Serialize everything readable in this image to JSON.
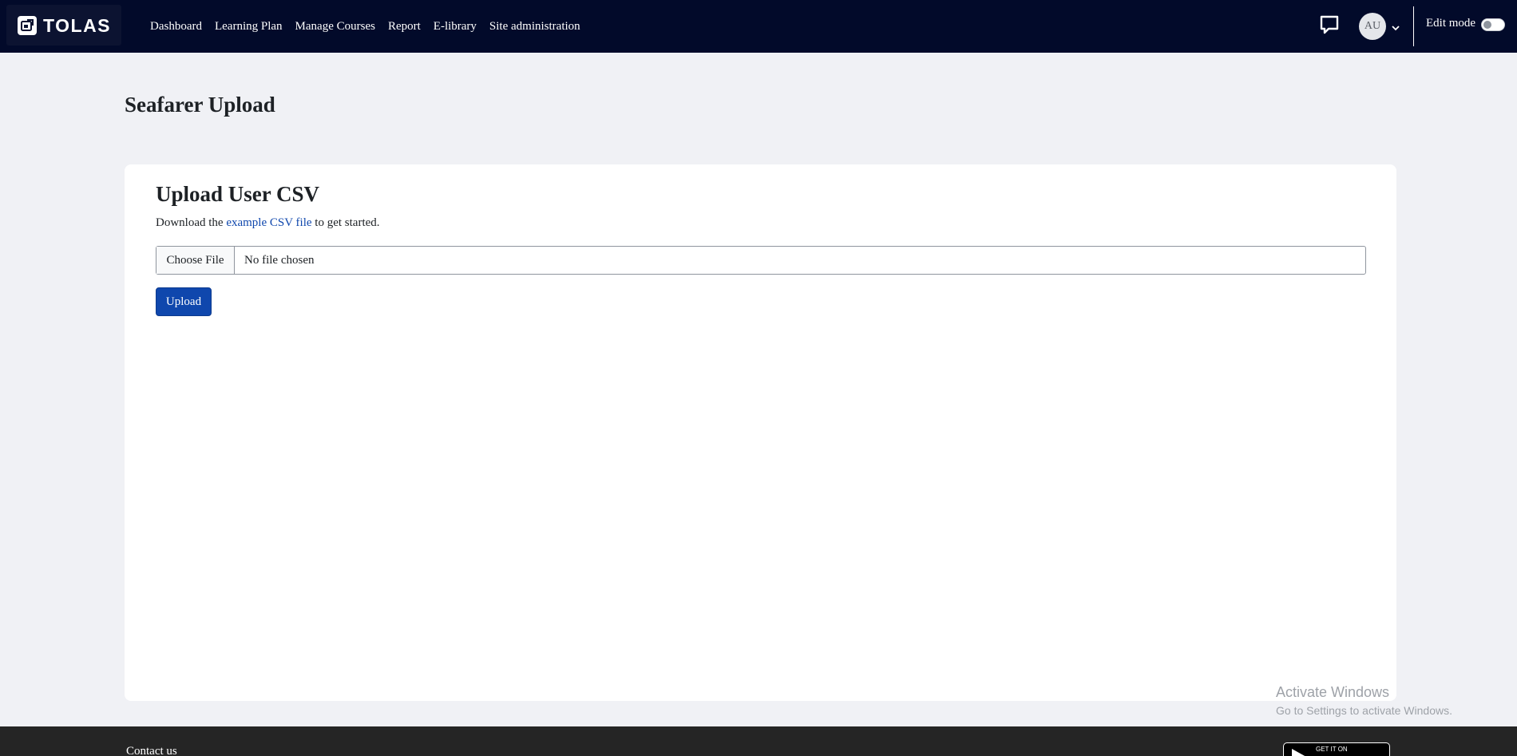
{
  "navbar": {
    "brand": "TOLAS",
    "links": [
      "Dashboard",
      "Learning Plan",
      "Manage Courses",
      "Report",
      "E-library",
      "Site administration"
    ],
    "avatar_initials": "AU",
    "edit_mode_label": "Edit mode",
    "edit_mode_on": false,
    "icons": {
      "messages": "chat-bubble-icon",
      "caret": "chevron-down-icon"
    }
  },
  "page": {
    "title": "Seafarer Upload"
  },
  "card": {
    "title": "Upload User CSV",
    "intro_before": "Download the ",
    "intro_link": "example CSV file",
    "intro_after": " to get started.",
    "file_button": "Choose File",
    "file_status": "No file chosen",
    "upload_label": "Upload"
  },
  "watermark": {
    "title": "Activate Windows",
    "subtitle": "Go to Settings to activate Windows."
  },
  "footer": {
    "contact": "Contact us",
    "store_badge": "GET IT ON"
  },
  "colors": {
    "navbar": "#020a2a",
    "primary": "#0f47ad",
    "page_bg": "#f0f1f5",
    "footer": "#252525"
  }
}
